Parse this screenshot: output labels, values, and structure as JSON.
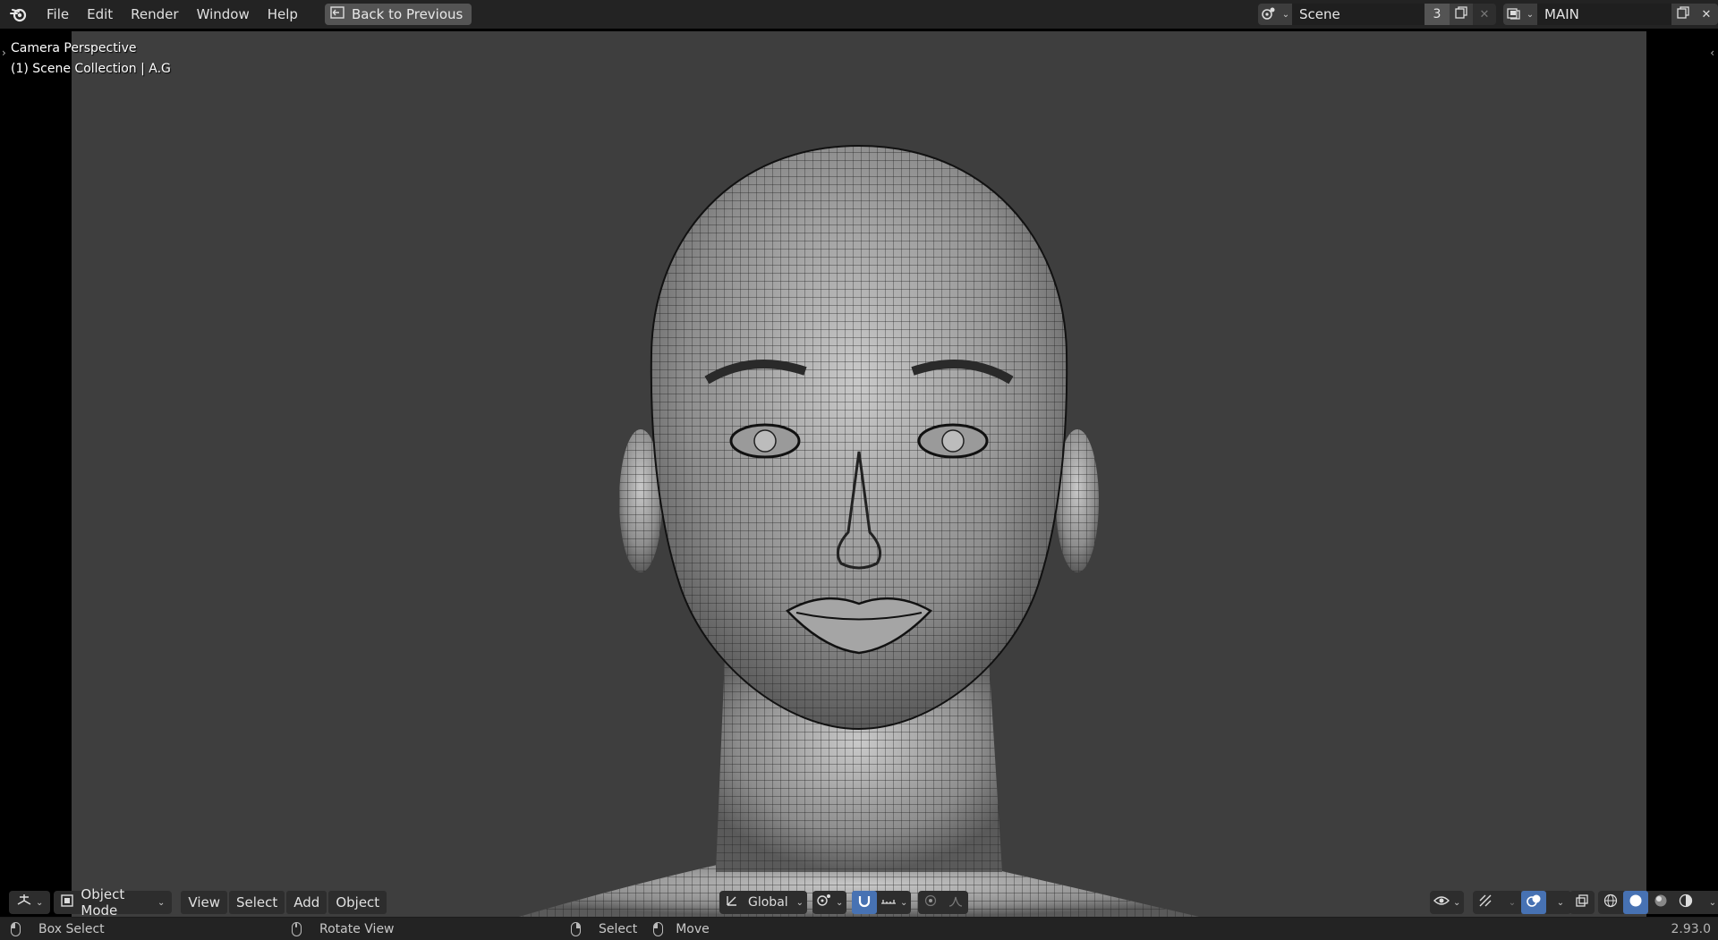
{
  "topbar": {
    "menus": [
      "File",
      "Edit",
      "Render",
      "Window",
      "Help"
    ],
    "back_label": "Back to Previous",
    "scene_name": "Scene",
    "scene_users": "3",
    "view_layer": "MAIN"
  },
  "viewport": {
    "overlay_line1": "Camera Perspective",
    "overlay_line2": "(1) Scene Collection | A.G"
  },
  "header": {
    "mode": "Object Mode",
    "menus": [
      "View",
      "Select",
      "Add",
      "Object"
    ],
    "transform_orientation": "Global"
  },
  "statusbar": {
    "left_action": "Box Select",
    "middle_action": "Rotate View",
    "right_action1": "Select",
    "right_action2": "Move",
    "version": "2.93.0"
  },
  "colors": {
    "accent": "#4772b3",
    "viewport_bg": "#3e3e3e",
    "topbar_bg": "#232323"
  }
}
